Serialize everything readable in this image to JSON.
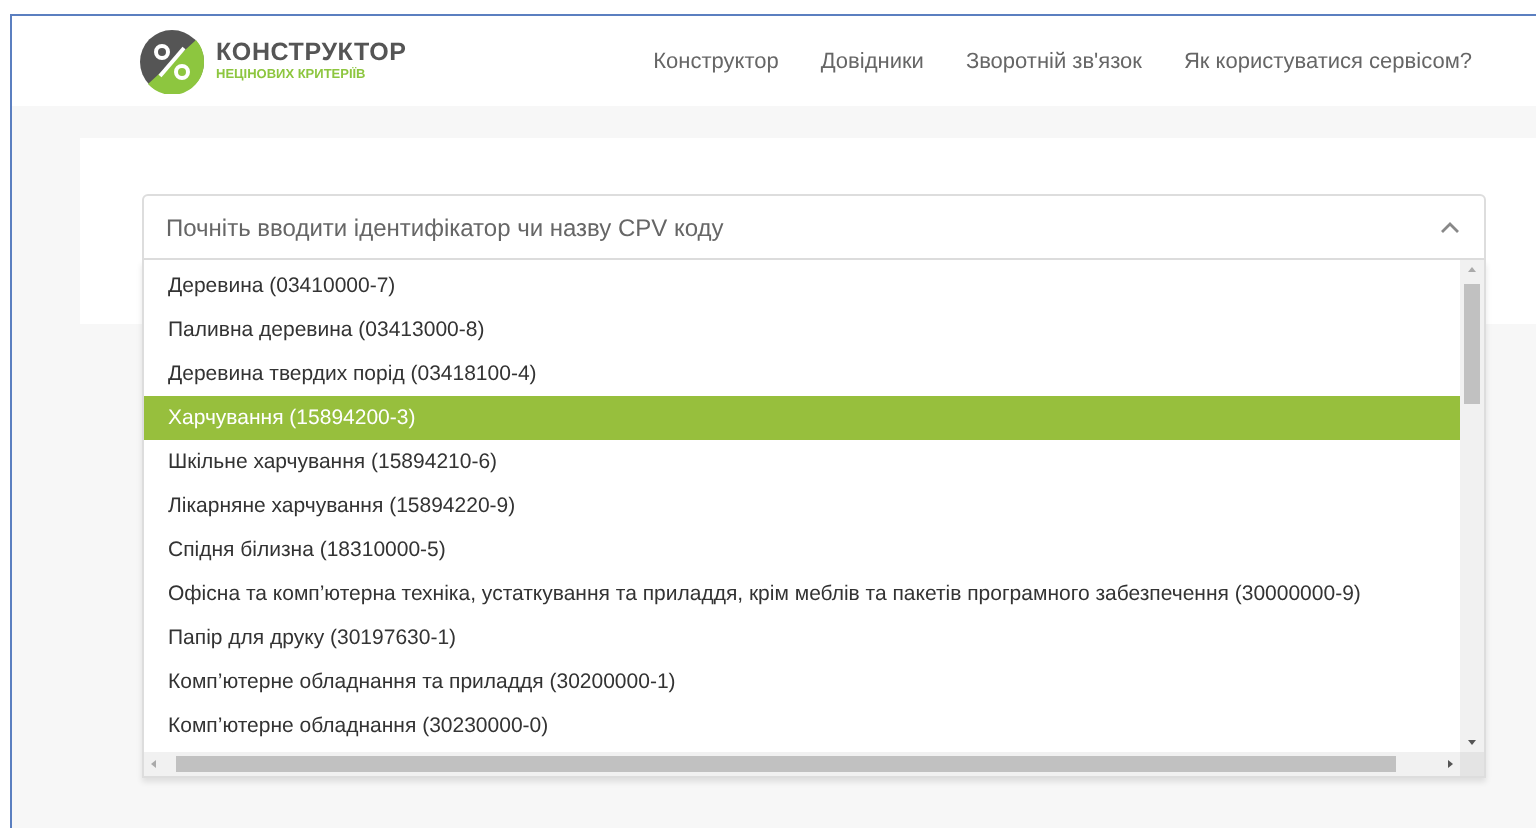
{
  "header": {
    "logo": {
      "title": "КОНСТРУКТОР",
      "subtitle": "НЕЦІНОВИХ КРИТЕРІЇВ"
    },
    "nav": [
      "Конструктор",
      "Довідники",
      "Зворотній зв'язок",
      "Як користуватися сервісом?"
    ]
  },
  "cpv_select": {
    "placeholder": "Почніть вводити ідентифікатор чи назву CPV коду",
    "expanded": true,
    "options": [
      {
        "label": "Деревина (03410000-7)",
        "selected": false
      },
      {
        "label": "Паливна деревина (03413000-8)",
        "selected": false
      },
      {
        "label": "Деревина твердих порід (03418100-4)",
        "selected": false
      },
      {
        "label": "Харчування (15894200-3)",
        "selected": true
      },
      {
        "label": "Шкільне харчування (15894210-6)",
        "selected": false
      },
      {
        "label": "Лікарняне харчування (15894220-9)",
        "selected": false
      },
      {
        "label": "Спідня білизна (18310000-5)",
        "selected": false
      },
      {
        "label": "Офісна та комп’ютерна техніка, устаткування та приладдя, крім меблів та пакетів програмного забезпечення (30000000-9)",
        "selected": false
      },
      {
        "label": "Папір для друку (30197630-1)",
        "selected": false
      },
      {
        "label": "Комп’ютерне обладнання та приладдя (30200000-1)",
        "selected": false
      },
      {
        "label": "Комп’ютерне обладнання (30230000-0)",
        "selected": false
      }
    ]
  }
}
